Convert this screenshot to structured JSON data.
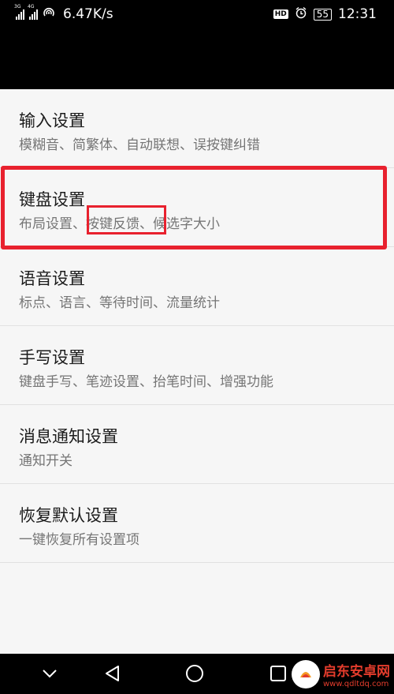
{
  "status_bar": {
    "signal1_tag": "3G",
    "signal2_tag": "4G",
    "net_speed": "6.47K/s",
    "hd_badge": "HD",
    "battery_level": "55",
    "time": "12:31"
  },
  "settings": [
    {
      "title": "输入设置",
      "subtitle": "模糊音、简繁体、自动联想、误按键纠错"
    },
    {
      "title": "键盘设置",
      "subtitle_parts": [
        "布局设置、",
        "按键反馈",
        "、候选字大小"
      ]
    },
    {
      "title": "语音设置",
      "subtitle": "标点、语言、等待时间、流量统计"
    },
    {
      "title": "手写设置",
      "subtitle": "键盘手写、笔迹设置、抬笔时间、增强功能"
    },
    {
      "title": "消息通知设置",
      "subtitle": "通知开关"
    },
    {
      "title": "恢复默认设置",
      "subtitle": "一键恢复所有设置项"
    }
  ],
  "annotation_color": "#e8212e",
  "nav_icons": [
    "chevron-down-icon",
    "back-icon",
    "home-icon",
    "recent-apps-icon"
  ],
  "watermark": {
    "name": "启东安卓网",
    "url": "www.qdltdq.com"
  }
}
